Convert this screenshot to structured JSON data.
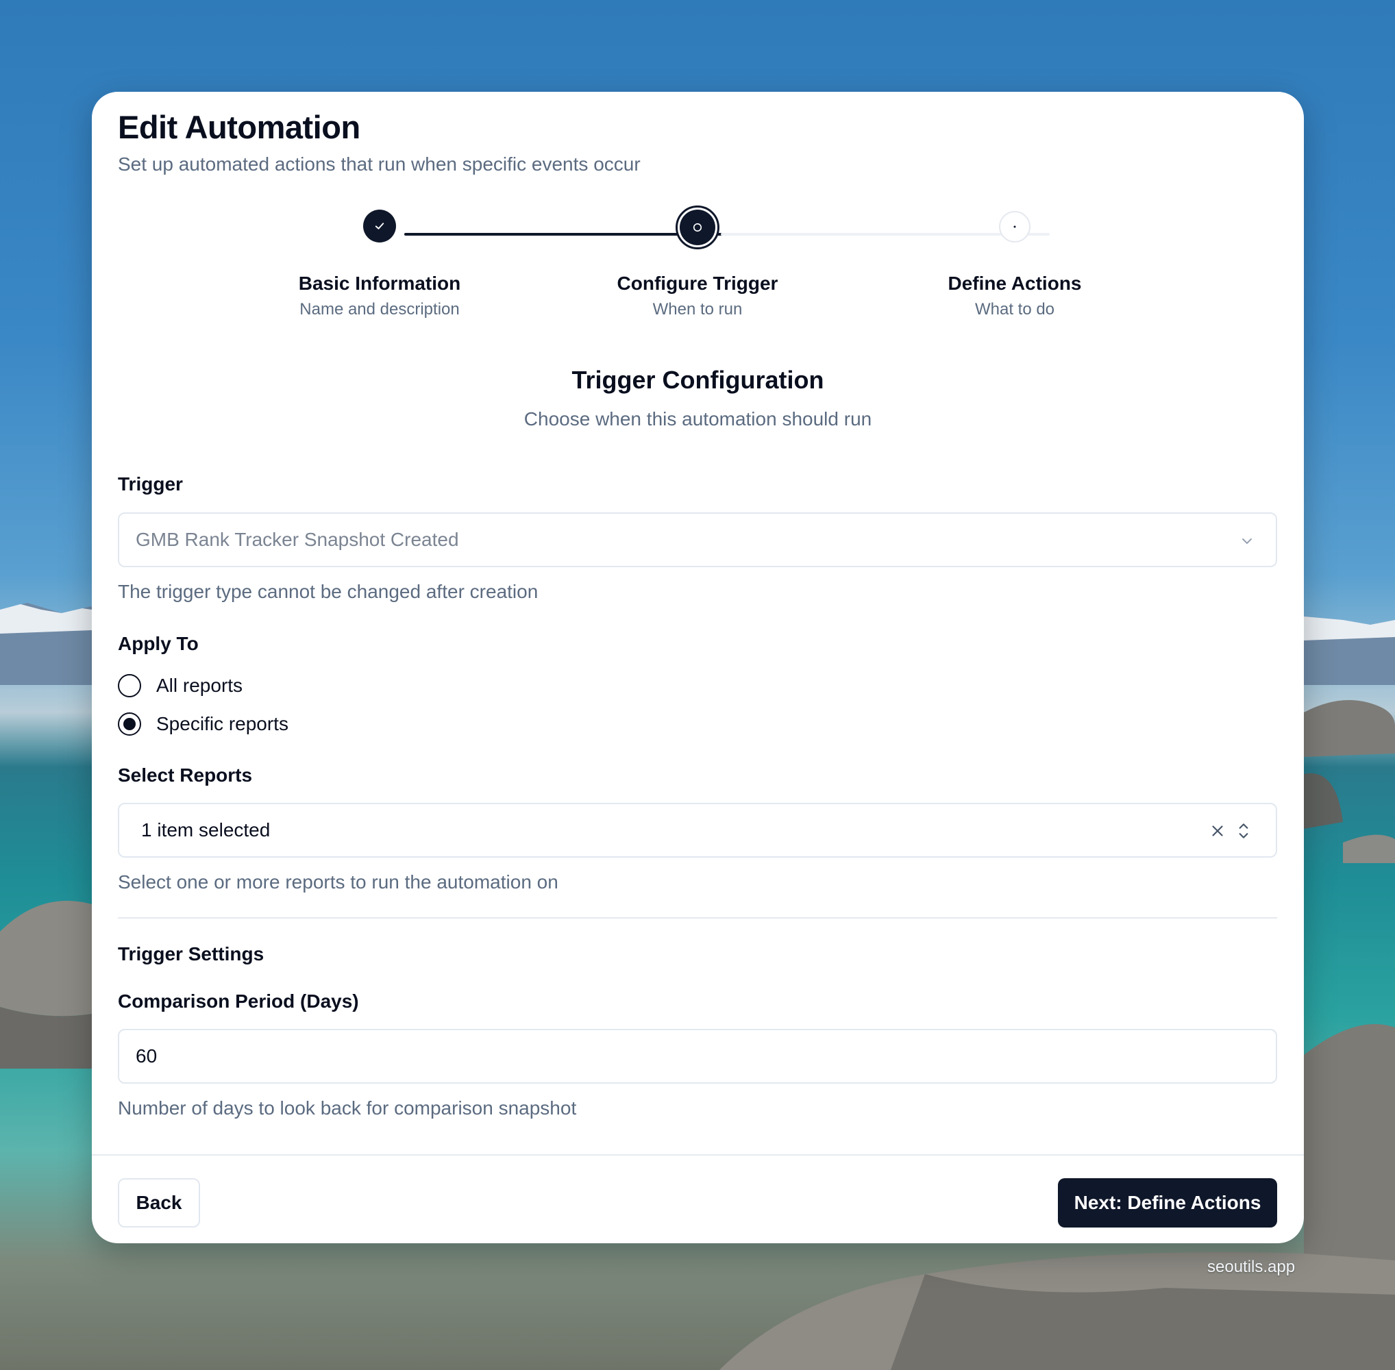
{
  "dialog": {
    "title": "Edit Automation",
    "subtitle": "Set up automated actions that run when specific events occur"
  },
  "stepper": {
    "steps": [
      {
        "title": "Basic Information",
        "desc": "Name and description",
        "state": "complete"
      },
      {
        "title": "Configure Trigger",
        "desc": "When to run",
        "state": "current"
      },
      {
        "title": "Define Actions",
        "desc": "What to do",
        "state": "upcoming"
      }
    ]
  },
  "section": {
    "title": "Trigger Configuration",
    "desc": "Choose when this automation should run"
  },
  "trigger": {
    "label": "Trigger",
    "value": "GMB Rank Tracker Snapshot Created",
    "help": "The trigger type cannot be changed after creation"
  },
  "apply_to": {
    "label": "Apply To",
    "options": [
      {
        "label": "All reports",
        "selected": false
      },
      {
        "label": "Specific reports",
        "selected": true
      }
    ]
  },
  "select_reports": {
    "label": "Select Reports",
    "value": "1 item selected",
    "help": "Select one or more reports to run the automation on"
  },
  "trigger_settings": {
    "title": "Trigger Settings",
    "comparison_label": "Comparison Period (Days)",
    "comparison_value": "60",
    "comparison_help": "Number of days to look back for comparison snapshot"
  },
  "footer": {
    "back_label": "Back",
    "next_label": "Next: Define Actions"
  },
  "watermark": "seoutils.app",
  "colors": {
    "primary": "#0f172a",
    "muted_text": "#5b6b80",
    "border": "#e2e8f0"
  }
}
